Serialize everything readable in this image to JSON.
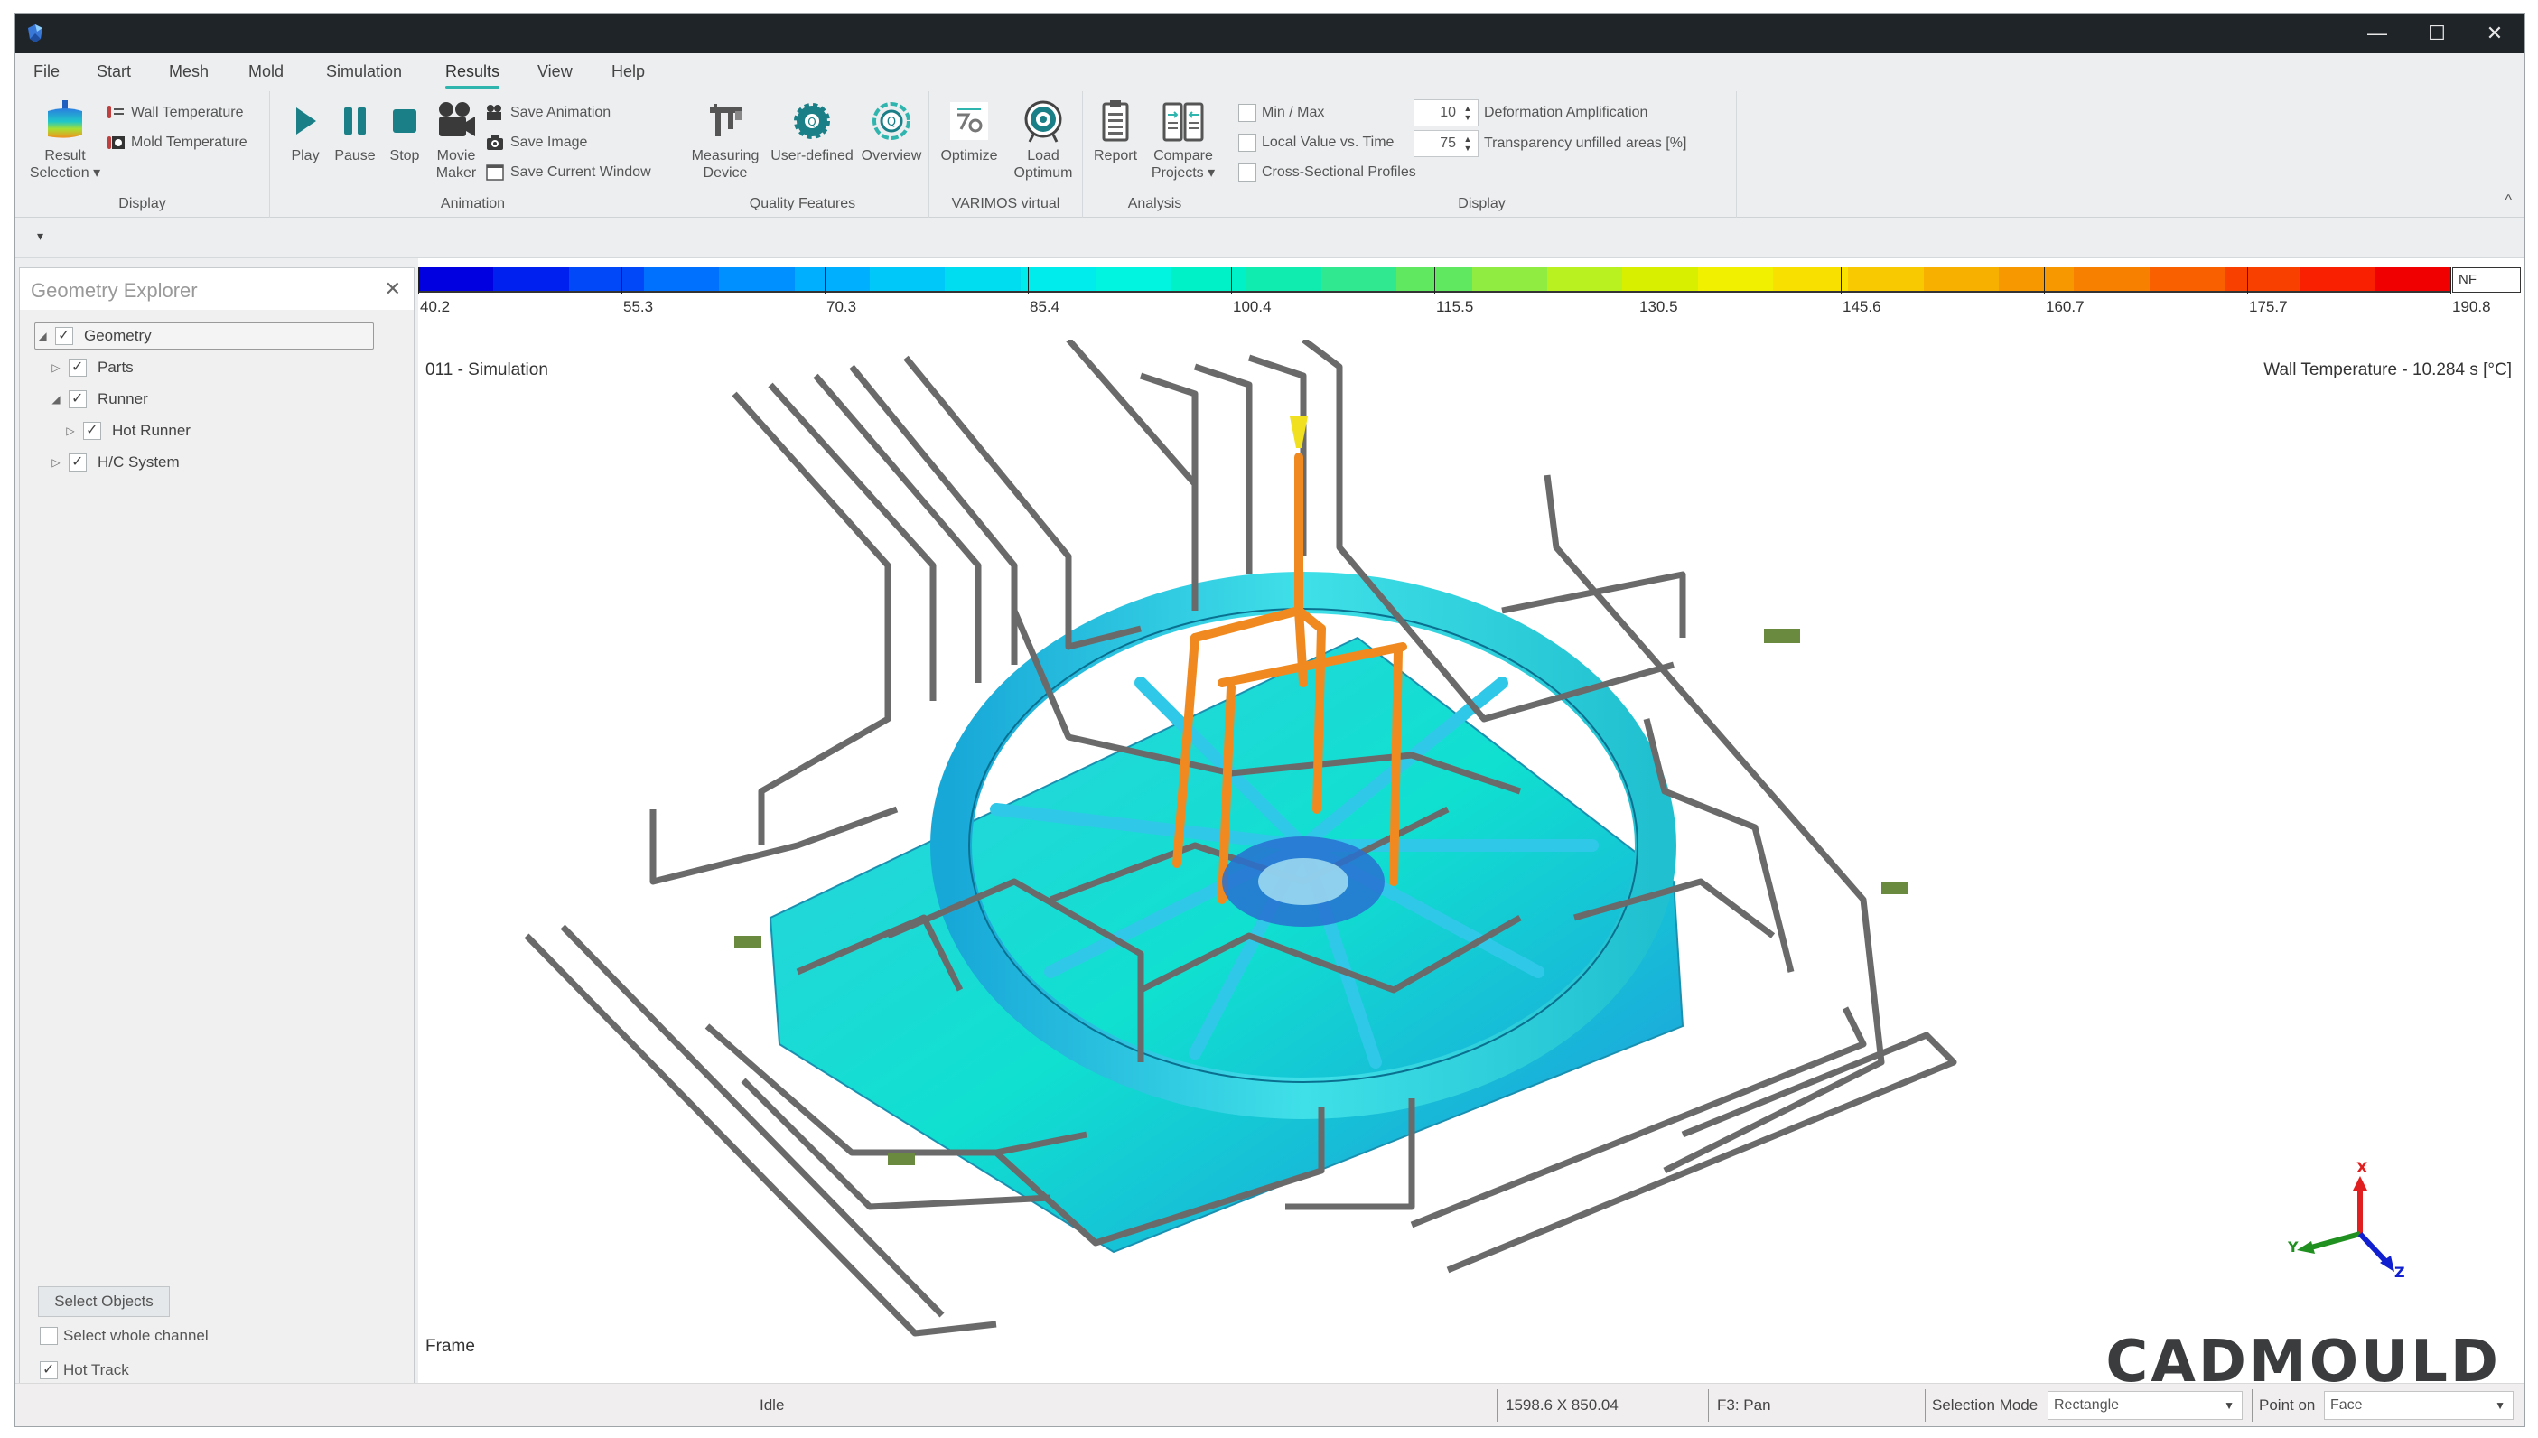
{
  "window": {
    "controls": {
      "minimize": "—",
      "maximize": "☐",
      "close": "✕"
    }
  },
  "menu": {
    "items": [
      "File",
      "Start",
      "Mesh",
      "Mold",
      "Simulation",
      "Results",
      "View",
      "Help"
    ],
    "active": "Results"
  },
  "ribbon": {
    "groups": {
      "display1": {
        "label": "Display",
        "result_selection": "Result\nSelection",
        "result_selection_line1": "Result",
        "result_selection_line2": "Selection ▾",
        "wall_temperature": "Wall Temperature",
        "mold_temperature": "Mold Temperature"
      },
      "animation": {
        "label": "Animation",
        "play": "Play",
        "pause": "Pause",
        "stop": "Stop",
        "movie_maker_line1": "Movie",
        "movie_maker_line2": "Maker",
        "save_animation": "Save Animation",
        "save_image": "Save Image",
        "save_current_window": "Save Current Window"
      },
      "quality": {
        "label": "Quality Features",
        "measuring_line1": "Measuring",
        "measuring_line2": "Device",
        "user_defined": "User-defined",
        "overview": "Overview"
      },
      "varimos": {
        "label": "VARIMOS virtual",
        "optimize": "Optimize",
        "load_optimum_line1": "Load",
        "load_optimum_line2": "Optimum"
      },
      "analysis": {
        "label": "Analysis",
        "report": "Report",
        "compare_line1": "Compare",
        "compare_line2": "Projects ▾"
      },
      "display2": {
        "label": "Display",
        "min_max": {
          "label": "Min / Max",
          "checked": false
        },
        "local_value": {
          "label": "Local Value vs. Time",
          "checked": false
        },
        "cross_section": {
          "label": "Cross-Sectional Profiles",
          "checked": false
        },
        "deformation": {
          "value": "10",
          "label": "Deformation Amplification"
        },
        "transparency": {
          "value": "75",
          "label": "Transparency unfilled areas [%]"
        }
      }
    },
    "collapse_icon": "^"
  },
  "quick_access": {
    "arrow": "▾"
  },
  "geometry_explorer": {
    "title": "Geometry Explorer",
    "close": "✕",
    "tree": [
      {
        "label": "Geometry",
        "expanded": true,
        "checked": true,
        "level": 0,
        "toggle": "◢",
        "selected": true
      },
      {
        "label": "Parts",
        "expanded": false,
        "checked": true,
        "level": 1,
        "toggle": "▷"
      },
      {
        "label": "Runner",
        "expanded": true,
        "checked": true,
        "level": 1,
        "toggle": "◢"
      },
      {
        "label": "Hot Runner",
        "expanded": false,
        "checked": true,
        "level": 2,
        "toggle": "▷"
      },
      {
        "label": "H/C System",
        "expanded": false,
        "checked": true,
        "level": 1,
        "toggle": "▷"
      }
    ],
    "select_objects": "Select Objects",
    "select_whole_channel": {
      "label": "Select whole channel",
      "checked": false
    },
    "hot_track": {
      "label": "Hot Track",
      "checked": true
    }
  },
  "viewport": {
    "simulation_title": "011 - Simulation",
    "result_title": "Wall Temperature - 10.284 s [°C]",
    "frame_label": "Frame",
    "brand": "CADMOULD",
    "axes": {
      "x": "X",
      "y": "Y",
      "z": "Z"
    },
    "legend": {
      "ticks": [
        "40.2",
        "55.3",
        "70.3",
        "85.4",
        "100.4",
        "115.5",
        "130.5",
        "145.6",
        "160.7",
        "175.7",
        "190.8"
      ],
      "not_filled": "NF",
      "min": 40.2,
      "max": 190.8,
      "unit": "°C",
      "colors": [
        "#0000e0",
        "#0020f0",
        "#0048f8",
        "#0070ff",
        "#0090ff",
        "#00b0ff",
        "#00c8f8",
        "#00dcf0",
        "#00ecec",
        "#00f4e0",
        "#00f0c8",
        "#10ecb0",
        "#30e890",
        "#60e860",
        "#90ec40",
        "#b8f020",
        "#d8f000",
        "#f0f000",
        "#f8e000",
        "#f8c800",
        "#f8b000",
        "#f89800",
        "#f88000",
        "#f86000",
        "#f84000",
        "#f82000",
        "#f00000"
      ]
    }
  },
  "statusbar": {
    "state": "Idle",
    "coordinates": "1598.6 X 850.04",
    "hint": "F3: Pan",
    "selection_mode_label": "Selection Mode",
    "selection_mode_value": "Rectangle",
    "point_on_label": "Point on",
    "point_on_value": "Face"
  },
  "colors": {
    "accent": "#2fb5ae",
    "titlebar": "#1f2428",
    "ribbon_bg": "#eceef0",
    "hot_runner": "#f08a20",
    "part": "#20c8d8",
    "cooling": "#707070"
  }
}
